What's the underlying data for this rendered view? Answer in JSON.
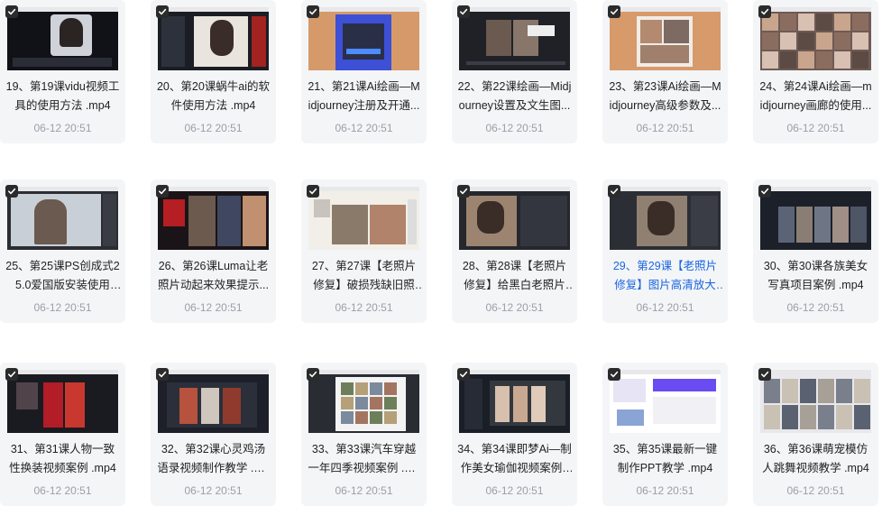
{
  "cards": [
    {
      "title": "19、第19课vidu视频工具的使用方法 .mp4",
      "date": "06-12 20:51",
      "theme": "dark-portrait"
    },
    {
      "title": "20、第20课蜗牛ai的软件使用方法 .mp4",
      "date": "06-12 20:51",
      "theme": "dark-portrait-side"
    },
    {
      "title": "21、第21课Ai绘画—Midjourney注册及开通...",
      "date": "06-12 20:51",
      "theme": "orange-form"
    },
    {
      "title": "22、第22课绘画—Midjourney设置及文生图...",
      "date": "06-12 20:51",
      "theme": "dark-dialog"
    },
    {
      "title": "23、第23课Ai绘画—Midjourney高级参数及...",
      "date": "06-12 20:51",
      "theme": "orange-gallery"
    },
    {
      "title": "24、第24课Ai绘画—midjourney画廊的使用...",
      "date": "06-12 20:51",
      "theme": "photo-grid"
    },
    {
      "title": "25、第25课PS创成式25.0爱国版安装使用方...",
      "date": "06-12 20:51",
      "theme": "ps-snow"
    },
    {
      "title": "26、第26课Luma让老照片动起来效果提示...",
      "date": "06-12 20:51",
      "theme": "red-collage"
    },
    {
      "title": "27、第27课【老照片修复】破损残缺旧照片...",
      "date": "06-12 20:51",
      "theme": "old-photos"
    },
    {
      "title": "28、第28课【老照片修复】给黑白老照片上...",
      "date": "06-12 20:51",
      "theme": "old-color"
    },
    {
      "title": "29、第29课【老照片修复】图片高清放大教...",
      "date": "06-12 20:51",
      "theme": "old-ps",
      "active": true
    },
    {
      "title": "30、第30课各族美女写真项目案例 .mp4",
      "date": "06-12 20:51",
      "theme": "dark-grid"
    },
    {
      "title": "31、第31课人物一致性换装视频案例 .mp4",
      "date": "06-12 20:51",
      "theme": "dark-pair"
    },
    {
      "title": "32、第32课心灵鸡汤语录视频制作教学 .mp4",
      "date": "06-12 20:51",
      "theme": "dark-elders"
    },
    {
      "title": "33、第33课汽车穿越一年四季视频案例 .mp4",
      "date": "06-12 20:51",
      "theme": "dialog-grid"
    },
    {
      "title": "34、第34课即梦Ai—制作美女瑜伽视频案例 .mp4",
      "date": "06-12 20:51",
      "theme": "dark-yoga"
    },
    {
      "title": "35、第35课最新一键制作PPT教学 .mp4",
      "date": "06-12 20:51",
      "theme": "web-ppt"
    },
    {
      "title": "36、第36课萌宠模仿人跳舞视频教学 .mp4",
      "date": "06-12 20:51",
      "theme": "pet-grid"
    }
  ]
}
